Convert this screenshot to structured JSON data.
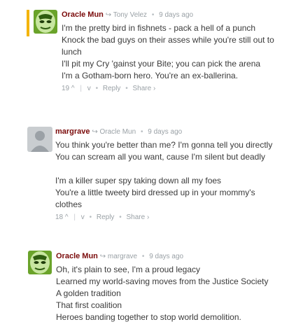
{
  "comments": [
    {
      "author": "Oracle Mun",
      "reply_to": "Tony Velez",
      "time": "9 days ago",
      "lines": [
        "I'm the pretty bird in fishnets - pack a hell of a punch",
        "Knock the bad guys on their asses while you're still out to lunch",
        "I'll pit my Cry 'gainst your Bite; you can pick the arena",
        "I'm a Gotham-born hero. You're an ex-ballerina."
      ],
      "votes": "19",
      "up_glyph": "^",
      "down_glyph": "v",
      "reply_label": "Reply",
      "share_label": "Share ›"
    },
    {
      "author": "margrave",
      "reply_to": "Oracle Mun",
      "time": "9 days ago",
      "lines": [
        "You think you're better than me? I'm gonna tell you directly",
        "You can scream all you want, cause I'm silent but deadly"
      ],
      "lines2": [
        "I'm a killer super spy taking down all my foes",
        "You're a little tweety bird dressed up in your mommy's clothes"
      ],
      "votes": "18",
      "up_glyph": "^",
      "down_glyph": "v",
      "reply_label": "Reply",
      "share_label": "Share ›"
    },
    {
      "author": "Oracle Mun",
      "reply_to": "margrave",
      "time": "9 days ago",
      "lines": [
        "Oh, it's plain to see, I'm a proud legacy",
        "Learned my world-saving moves from the Justice Society",
        "A golden tradition",
        "That first coalition",
        "Heroes banding together to stop world demolition."
      ]
    }
  ],
  "colors": {
    "author": "#7a0a0a",
    "highlight": "#f4b400",
    "meta": "#9aa1a6",
    "text": "#3a3a3a",
    "avatar_green": "#8fc83a"
  },
  "icons": {
    "reply_arrow": "↪",
    "dot": "•",
    "separator": "|"
  }
}
